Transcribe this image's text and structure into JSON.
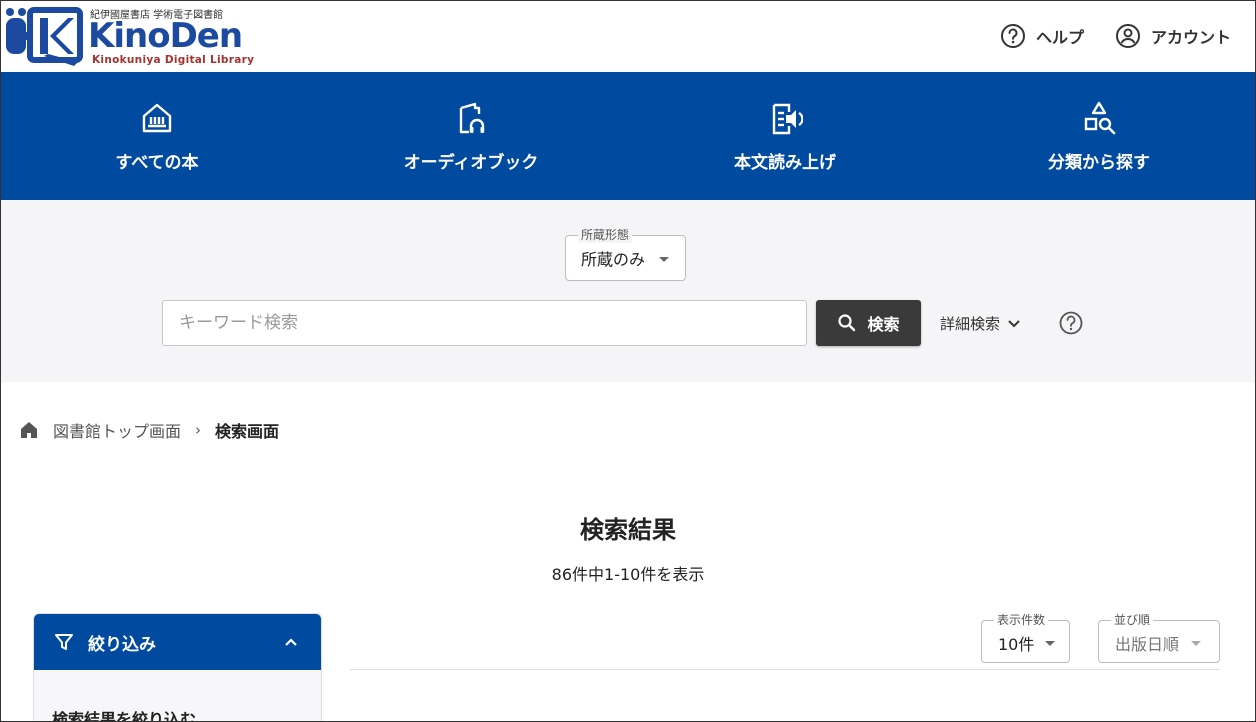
{
  "header": {
    "logo_top_text": "紀伊國屋書店 学術電子図書館",
    "logo_main_text": "KinoDen",
    "logo_bottom_text": "Kinokuniya Digital Library",
    "help_label": "ヘルプ",
    "account_label": "アカウント"
  },
  "nav": {
    "items": [
      {
        "label": "すべての本",
        "icon": "library-icon"
      },
      {
        "label": "オーディオブック",
        "icon": "audiobook-icon"
      },
      {
        "label": "本文読み上げ",
        "icon": "read-aloud-icon"
      },
      {
        "label": "分類から探す",
        "icon": "category-search-icon"
      }
    ]
  },
  "search": {
    "holding_label": "所蔵形態",
    "holding_value": "所蔵のみ",
    "keyword_placeholder": "キーワード検索",
    "keyword_value": "",
    "search_button_label": "検索",
    "advanced_label": "詳細検索"
  },
  "breadcrumb": {
    "home_label": "図書館トップ画面",
    "separator": "›",
    "current_label": "検索画面"
  },
  "results": {
    "title": "検索結果",
    "count_text": "86件中1-10件を表示",
    "per_page_label": "表示件数",
    "per_page_value": "10件",
    "sort_label": "並び順",
    "sort_value": "出版日順"
  },
  "filter": {
    "title": "絞り込み",
    "subtitle": "検索結果を絞り込む"
  },
  "colors": {
    "brand_blue": "#004a9f",
    "search_button": "#3a3a3a",
    "logo_red": "#a4332e"
  }
}
